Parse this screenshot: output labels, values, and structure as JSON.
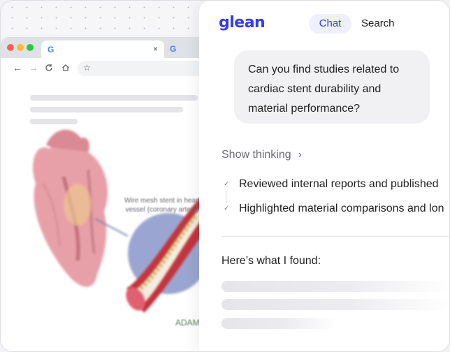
{
  "browser": {
    "tab_favicon": "G",
    "tab_close": "×",
    "second_tab_favicon": "G",
    "nav_icons": [
      "back-arrow-icon",
      "forward-arrow-icon",
      "reload-icon",
      "home-icon",
      "star-icon"
    ],
    "illustration_caption": "Wire mesh stent in heart vessel (coronary artery)",
    "illustration_logo": "ADAM"
  },
  "panel": {
    "logo": "glean",
    "tabs": [
      {
        "label": "Chat",
        "active": true
      },
      {
        "label": "Search",
        "active": false
      }
    ],
    "query": "Can you find studies related to cardiac stent durability and material performance?",
    "show_thinking": "Show thinking",
    "chevron": "›",
    "steps": [
      "Reviewed internal reports and published",
      "Highlighted material comparisons and lon"
    ],
    "check_glyph": "✓",
    "result_intro": "Here’s what I found:"
  },
  "colors": {
    "accent": "#343ced",
    "accent_bg": "#eef0fc",
    "bubble_bg": "#f1f1f3"
  }
}
